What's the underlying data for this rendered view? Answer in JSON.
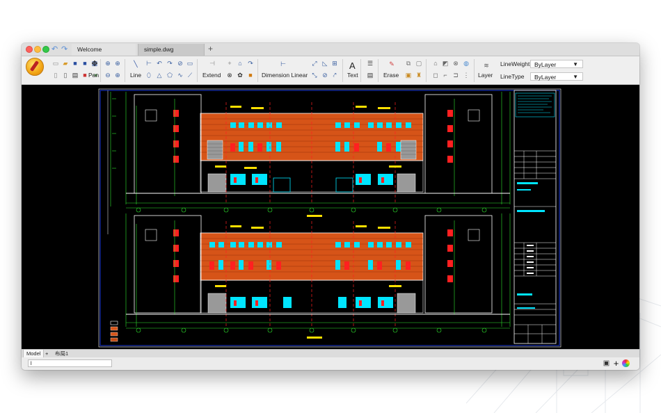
{
  "tabs": {
    "welcome": "Welcome",
    "active": "simple.dwg",
    "add": "+"
  },
  "toolbar": {
    "pan": "Pan",
    "line": "Line",
    "extend": "Extend",
    "dimension": "Dimension Linear",
    "text": "Text",
    "text_glyph": "A",
    "erase": "Erase",
    "layer": "Layer",
    "lineweight_label": "LineWeight",
    "lineweight_value": "ByLayer",
    "linetype_label": "LineType",
    "linetype_value": "ByLayer"
  },
  "layout_tabs": {
    "model": "Model",
    "add": "+",
    "layout1": "布局1"
  },
  "command": {
    "value": "l"
  },
  "colors": {
    "canvas_bg": "#000000",
    "accent_orange": "#e05a1a",
    "drawing_cyan": "#00e5ff",
    "drawing_white": "#ffffff",
    "drawing_green": "#2fe62f",
    "drawing_red": "#ff2020",
    "drawing_yellow": "#ffe000"
  }
}
